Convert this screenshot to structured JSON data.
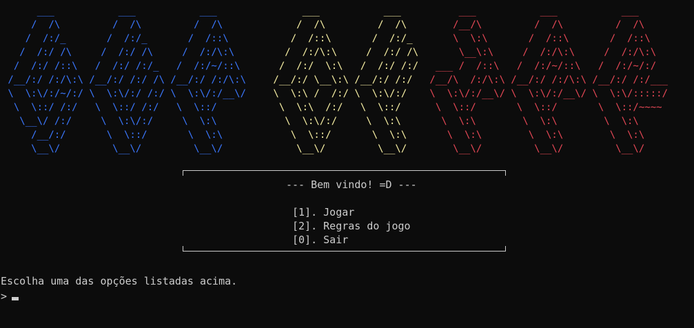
{
  "colors": {
    "background": "#0c0c0c",
    "text": "#cccccc",
    "art_blue": "#3b78ff",
    "art_yellow": "#f9f1a5",
    "art_red": "#e74856"
  },
  "ascii_art": {
    "blue": "      ___           ___           ___\n     /  /\\         /  /\\         /  /\\\n    /  /:/_       /  /:/_       /  /::\\\n   /  /:/ /\\     /  /:/ /\\     /  /:/\\:\\\n  /  /:/ /::\\   /  /:/ /:/_   /  /:/~/::\\\n /__/:/ /:/\\:\\ /__/:/ /:/ /\\ /__/:/ /:/\\:\\\n \\  \\:\\/:/~/:/ \\  \\:\\/:/ /:/ \\  \\:\\/:/__\\/\n  \\  \\::/ /:/   \\  \\::/ /:/   \\  \\::/\n   \\__\\/ /:/     \\  \\:\\/:/     \\  \\:\\\n     /__/:/       \\  \\::/       \\  \\:\\\n     \\__\\/         \\__\\/         \\__\\/",
    "yellow": "      ___           ___\n     /  /\\         /  /\\\n    /  /::\\       /  /:/_\n   /  /:/\\:\\     /  /:/ /\\\n  /  /:/  \\:\\   /  /:/ /:/\n /__/:/ \\__\\:\\ /__/:/ /:/\n \\  \\:\\ /  /:/ \\  \\:\\/:/\n  \\  \\:\\  /:/   \\  \\::/\n   \\  \\:\\/:/     \\  \\:\\\n    \\  \\::/       \\  \\:\\\n     \\__\\/         \\__\\/",
    "red": "      ___           ___           ___\n     /__/\\         /  /\\         /  /\\\n     \\  \\:\\       /  /::\\       /  /::\\\n      \\__\\:\\     /  /:/\\:\\     /  /:/\\:\\\n  ___ /  /::\\   /  /:/~/::\\   /  /:/~/:/\n /__/\\  /:/\\:\\ /__/:/ /:/\\:\\ /__/:/ /:/___\n \\  \\:\\/:/__\\/ \\  \\:\\/:/__\\/ \\  \\:\\/:::::/\n  \\  \\::/       \\  \\::/       \\  \\::/~~~~\n   \\  \\:\\        \\  \\:\\        \\  \\:\\\n    \\  \\:\\        \\  \\:\\        \\  \\:\\\n     \\__\\/         \\__\\/         \\__\\/"
  },
  "menu": {
    "welcome": "--- Bem vindo! =D ---",
    "options": [
      "[1]. Jogar",
      "[2]. Regras do jogo",
      "[0]. Sair"
    ]
  },
  "prompt": {
    "instruction": "Escolha uma das opções listadas acima.",
    "symbol": ">"
  }
}
